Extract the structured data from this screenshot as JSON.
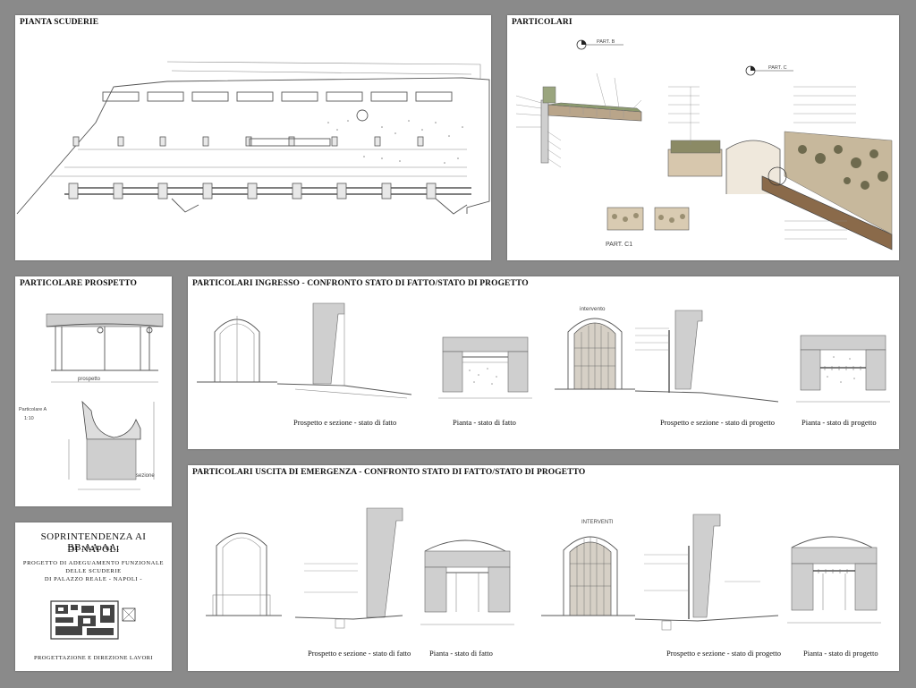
{
  "panels": {
    "pianta": {
      "title": "PIANTA SCUDERIE"
    },
    "particolari": {
      "title": "PARTICOLARI",
      "labels": {
        "part_b": "PART. B",
        "part_c": "PART. C",
        "part_c1": "PART. C1"
      }
    },
    "prospetto": {
      "title": "PARTICOLARE PROSPETTO",
      "labels": {
        "prospetto": "prospetto",
        "sezione": "sezione",
        "particolare": "Particolare A",
        "scale": "1:10"
      }
    },
    "ingresso": {
      "title": "PARTICOLARI INGRESSO - CONFRONTO STATO DI FATTO/STATO DI PROGETTO",
      "captions": [
        "Prospetto e sezione - stato di fatto",
        "Pianta - stato di fatto",
        "Prospetto e sezione - stato di progetto",
        "Pianta - stato di progetto"
      ],
      "labels": {
        "intervento": "intervento"
      }
    },
    "emergenza": {
      "title": "PARTICOLARI USCITA DI EMERGENZA - CONFRONTO STATO DI FATTO/STATO DI PROGETTO",
      "captions": [
        "Prospetto e sezione - stato di fatto",
        "Pianta - stato di fatto",
        "Prospetto e sezione - stato di progetto",
        "Pianta - stato di progetto"
      ],
      "labels": {
        "interventi": "INTERVENTI"
      }
    },
    "soprintendenza": {
      "line1": "SOPRINTENDENZA AI BB.AA.AA.",
      "line2": "DI NAPOLI",
      "project1": "PROGETTO DI ADEGUAMENTO FUNZIONALE",
      "project2": "DELLE SCUDERIE",
      "project3": "DI PALAZZO REALE - NAPOLI -",
      "footer": "PROGETTAZIONE E DIREZIONE LAVORI"
    }
  }
}
